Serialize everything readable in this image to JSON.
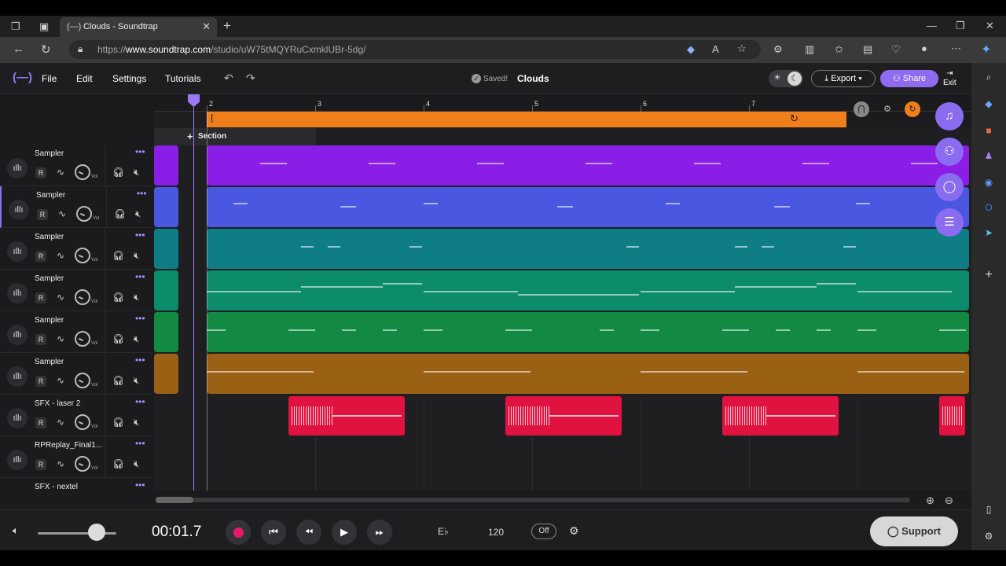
{
  "browser": {
    "tab_title": "Clouds - Soundtrap",
    "url_prefix": "https://",
    "url_host": "www.soundtrap.com",
    "url_path": "/studio/uW75tMQYRuCxmklUBr-5dg/"
  },
  "menu": {
    "logo": "(—)",
    "file": "File",
    "edit": "Edit",
    "settings": "Settings",
    "tutorials": "Tutorials",
    "saved": "Saved!",
    "project_name": "Clouds",
    "export": "Export",
    "share": "Share",
    "exit": "Exit"
  },
  "ruler": {
    "bars": [
      "2",
      "3",
      "4",
      "5",
      "6",
      "7"
    ]
  },
  "section_label": "Section",
  "tracks": [
    {
      "name": "Sampler",
      "color": "#8a1ee6"
    },
    {
      "name": "Sampler",
      "color": "#4a57e0"
    },
    {
      "name": "Sampler",
      "color": "#0f7d86"
    },
    {
      "name": "Sampler",
      "color": "#0d8c6c"
    },
    {
      "name": "Sampler",
      "color": "#138a43"
    },
    {
      "name": "Sampler",
      "color": "#9a6114"
    },
    {
      "name": "SFX - laser 2",
      "color": "#e0123f"
    },
    {
      "name": "RPReplay_Final1...",
      "color": "#e0123f"
    },
    {
      "name": "SFX - nextel",
      "color": "#e0123f"
    }
  ],
  "track_controls": {
    "record": "R",
    "volume_label": "Vol"
  },
  "transport": {
    "time": "00:01.7",
    "key": "E♭",
    "tempo": "120",
    "metronome": "Off",
    "support": "Support"
  },
  "colors": {
    "accent": "#8f6bf0",
    "loop": "#f07e1b",
    "record": "#e8196c"
  }
}
